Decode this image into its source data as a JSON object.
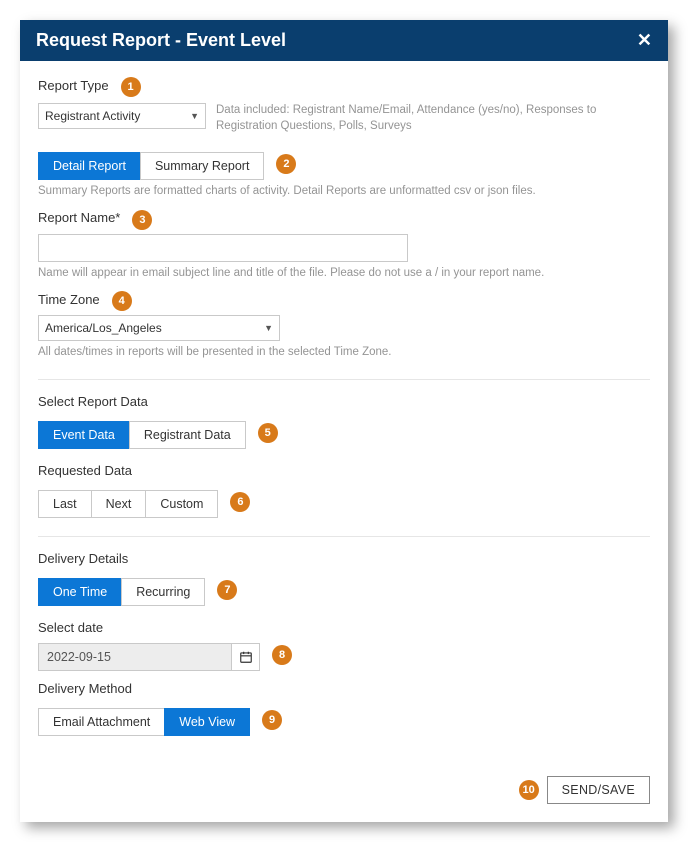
{
  "header": {
    "title": "Request Report - Event Level"
  },
  "reportType": {
    "label": "Report Type",
    "selected": "Registrant Activity",
    "help": "Data included: Registrant Name/Email, Attendance (yes/no), Responses to Registration Questions, Polls, Surveys"
  },
  "reportMode": {
    "options": [
      "Detail Report",
      "Summary Report"
    ],
    "help": "Summary Reports are formatted charts of activity. Detail Reports are unformatted csv or json files."
  },
  "reportName": {
    "label": "Report Name*",
    "value": "",
    "help": "Name will appear in email subject line and title of the file. Please do not use a / in your report name."
  },
  "timeZone": {
    "label": "Time Zone",
    "selected": "America/Los_Angeles",
    "help": "All dates/times in reports will be presented in the selected Time Zone."
  },
  "selectReportData": {
    "label": "Select Report Data",
    "options": [
      "Event Data",
      "Registrant Data"
    ]
  },
  "requestedData": {
    "label": "Requested Data",
    "options": [
      "Last",
      "Next",
      "Custom"
    ]
  },
  "deliveryDetails": {
    "label": "Delivery Details",
    "options": [
      "One Time",
      "Recurring"
    ]
  },
  "selectDate": {
    "label": "Select date",
    "value": "2022-09-15"
  },
  "deliveryMethod": {
    "label": "Delivery Method",
    "options": [
      "Email Attachment",
      "Web View"
    ]
  },
  "footer": {
    "sendSave": "SEND/SAVE"
  },
  "annotations": [
    "1",
    "2",
    "3",
    "4",
    "5",
    "6",
    "7",
    "8",
    "9",
    "10"
  ]
}
